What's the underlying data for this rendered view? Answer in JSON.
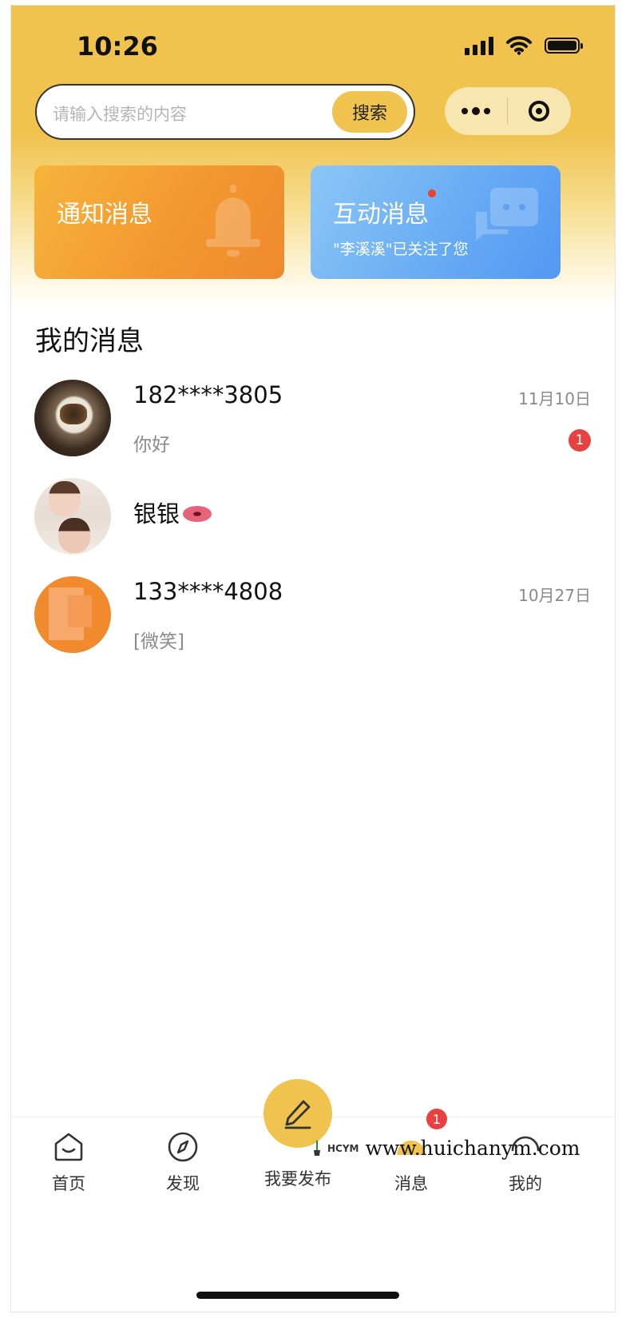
{
  "status_bar": {
    "time": "10:26"
  },
  "search": {
    "placeholder": "请输入搜索的内容",
    "button_label": "搜索"
  },
  "cards": {
    "notify": {
      "title": "通知消息"
    },
    "interact": {
      "title": "互动消息",
      "subtitle": "\"李溪溪\"已关注了您"
    }
  },
  "section": {
    "title": "我的消息"
  },
  "messages": [
    {
      "name": "182****3805",
      "text": "你好",
      "date": "11月10日",
      "unread": "1"
    },
    {
      "name": "银银",
      "text": "",
      "date": "",
      "unread": ""
    },
    {
      "name": "133****4808",
      "text": "[微笑]",
      "date": "10月27日",
      "unread": ""
    }
  ],
  "tabbar": {
    "items": [
      {
        "label": "首页",
        "icon": "home-icon"
      },
      {
        "label": "发现",
        "icon": "compass-icon"
      },
      {
        "label": "我要发布",
        "icon": "pencil-icon"
      },
      {
        "label": "消息",
        "icon": "message-icon",
        "badge": "1"
      },
      {
        "label": "我的",
        "icon": "user-icon"
      }
    ]
  },
  "watermark": {
    "logo": "HCYM",
    "text": "www.huichanym.com"
  },
  "colors": {
    "primary": "#f0c24e",
    "notify_card": "#f2962f",
    "interact_card": "#68acf4",
    "badge": "#e84142"
  }
}
